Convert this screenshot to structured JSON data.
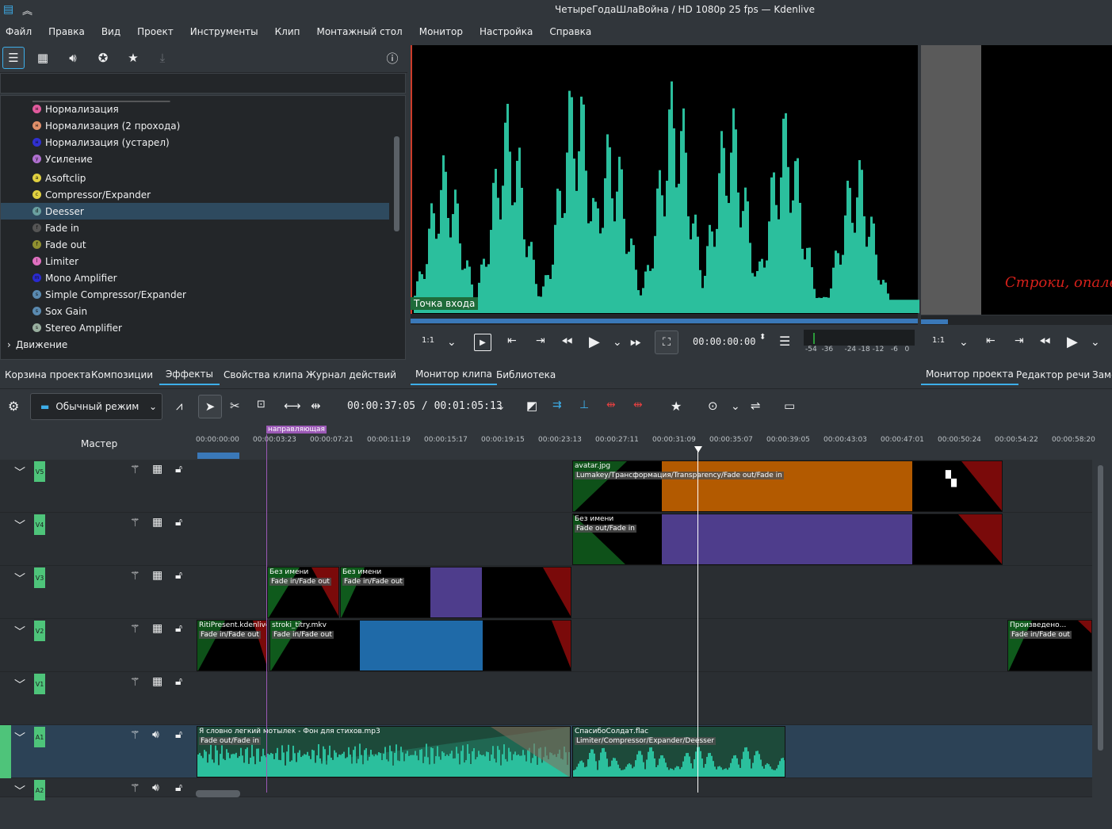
{
  "window": {
    "title": "ЧетыреГодаШлаВойна / HD 1080p 25 fps — Kdenlive"
  },
  "menu": [
    "Файл",
    "Правка",
    "Вид",
    "Проект",
    "Инструменты",
    "Клип",
    "Монтажный стол",
    "Монитор",
    "Настройка",
    "Справка"
  ],
  "effects": {
    "items": [
      {
        "label": "Нормализация",
        "color": "#e05a9c"
      },
      {
        "label": "Нормализация (2 прохода)",
        "color": "#e0906a"
      },
      {
        "label": "Нормализация (устарел)",
        "color": "#3030d0"
      },
      {
        "label": "Усиление",
        "color": "#b070d0"
      },
      {
        "label": "Asoftclip",
        "color": "#e0d040"
      },
      {
        "label": "Compressor/Expander",
        "color": "#e0d040"
      },
      {
        "label": "Deesser",
        "color": "#6aa0a0"
      },
      {
        "label": "Fade in",
        "color": "#555"
      },
      {
        "label": "Fade out",
        "color": "#909030"
      },
      {
        "label": "Limiter",
        "color": "#e070c0"
      },
      {
        "label": "Mono Amplifier",
        "color": "#2a2ad0"
      },
      {
        "label": "Simple Compressor/Expander",
        "color": "#5a8ab0"
      },
      {
        "label": "Sox Gain",
        "color": "#5a8ab0"
      },
      {
        "label": "Stereo Amplifier",
        "color": "#9ab0a0"
      }
    ],
    "selected": "Deesser",
    "category": "Движение"
  },
  "left_tabs": [
    "Корзина проекта",
    "Композиции",
    "Эффекты",
    "Свойства клипа",
    "Журнал действий"
  ],
  "left_tab_active": "Эффекты",
  "clip_monitor": {
    "in_point_label": "Точка  входа",
    "zoom": "1:1",
    "timecode": "00:00:00:00",
    "meter_labels": [
      "-54",
      "-36",
      "-24",
      "-18",
      "-12",
      "-6",
      "0"
    ]
  },
  "monitor_tabs": [
    "Монитор клипа",
    "Библиотека"
  ],
  "project_monitor": {
    "overlay_text": "Строки, опален",
    "zoom": "1:1"
  },
  "project_tabs": [
    "Монитор проекта",
    "Редактор речи",
    "Заме"
  ],
  "timeline_toolbar": {
    "mode": "Обычный режим",
    "timecode": "00:00:37:05  /  00:01:05:13"
  },
  "ruler": {
    "ticks": [
      "00:00:00:00",
      "00:00:03:23",
      "00:00:07:21",
      "00:00:11:19",
      "00:00:15:17",
      "00:00:19:15",
      "00:00:23:13",
      "00:00:27:11",
      "00:00:31:09",
      "00:00:35:07",
      "00:00:39:05",
      "00:00:43:03",
      "00:00:47:01",
      "00:00:50:24",
      "00:00:54:22",
      "00:00:58:20"
    ],
    "guide": "направляющая",
    "master": "Мастер"
  },
  "tracks": [
    {
      "tag": "V5"
    },
    {
      "tag": "V4"
    },
    {
      "tag": "V3"
    },
    {
      "tag": "V2"
    },
    {
      "tag": "V1"
    },
    {
      "tag": "A1"
    },
    {
      "tag": "A2"
    }
  ],
  "clips": {
    "v5_name": "avatar.jpg",
    "v5_fx": "Lumakey/Трансформация/Transparency/Fade out/Fade in",
    "v4_name": "Без имени",
    "v4_fx": "Fade out/Fade in",
    "v3a_name": "Без имени",
    "v3a_fx": "Fade in/Fade out",
    "v3b_name": "Без имени",
    "v3b_fx": "Fade in/Fade out",
    "v2a_name": "RitiPresent.kdenlivetit",
    "v2a_fx": "Fade in/Fade out",
    "v2b_name": "stroki_titry.mkv",
    "v2b_fx": "Fade in/Fade out",
    "v2c_name": "Произведено...",
    "v2c_fx": "Fade in/Fade out",
    "a1a_name": "Я словно легкий мотылек - Фон для стихов.mp3",
    "a1a_fx": "Fade out/Fade in",
    "a1b_name": "СпасибоСолдат.flac",
    "a1b_fx": "Limiter/Compressor/Expander/Deesser"
  },
  "colors": {
    "accent": "#3daee9",
    "audio_wave": "#2bbf9d",
    "orange": "#b35a00",
    "purple": "#4e3d8c",
    "blue": "#1f6aa8",
    "track_green": "#4ec47a"
  }
}
